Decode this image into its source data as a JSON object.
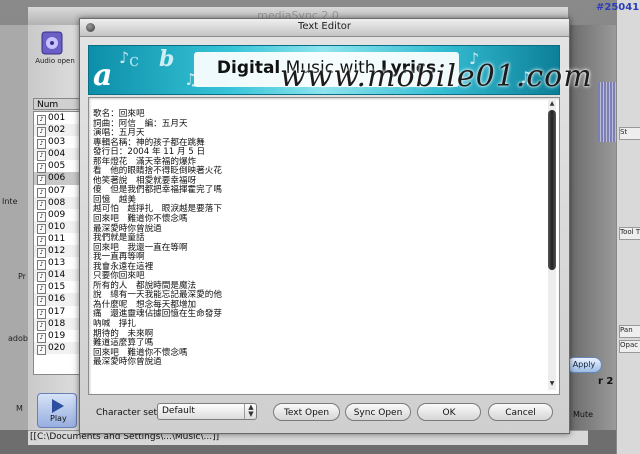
{
  "background_app": {
    "title": "mediaSync 2.0",
    "audio_open_label": "Audio open",
    "num_header": "Num",
    "tracks": [
      "001",
      "002",
      "003",
      "004",
      "005",
      "006",
      "007",
      "008",
      "009",
      "010",
      "011",
      "012",
      "013",
      "014",
      "015",
      "016",
      "017",
      "018",
      "019",
      "020"
    ],
    "left_labels": [
      "Inte",
      "Pr",
      "adob",
      "M"
    ],
    "play_label": "Play",
    "status_text": "[[C:\\Documents and Settings\\...\\Music\\...]]",
    "right_buttons": [
      "St",
      "Tool T",
      "Pan",
      "Opac"
    ],
    "apply_label": "Apply",
    "mute_label": "Mute",
    "r2_label": "r 2",
    "tag": "#25041"
  },
  "dialog": {
    "title": "Text Editor",
    "banner": {
      "title_plain": "Digital Music with ",
      "title_bold_a": "Digital",
      "title_bold_b": "Lyrics",
      "letters": [
        "a",
        "b",
        "c"
      ],
      "watermark": "www.mobile01.com"
    },
    "lyrics": [
      "歌名：回來吧",
      "詞曲：阿信　編：五月天",
      "演唱：五月天",
      "專輯名稱：神的孩子都在跳舞",
      "發行日：2004 年 11 月 5 日",
      "那年燈花　滿天幸福的爆炸",
      "看　他的眼睛捨不得眨倒映著火花",
      "他笑著說　相愛就要幸福呀",
      "傻　但是我們都把幸福揮霍完了嗎",
      "回憶　越美",
      "越可怕　越掙扎　眼淚越是要落下",
      "回來吧　難道你不懷念嗎",
      "最深愛時你曾說過",
      "我們就是童話",
      "回來吧　我還一直在等啊",
      "我一直再等啊",
      "我會永遠在這裡",
      "只要你回來吧",
      "所有的人　都說時間是魔法",
      "說　總有一天我能忘記最深愛的他",
      "為什麼呢　想念每天都增加",
      "痛　還進靈魂佔據回憶在生命發芽",
      "吶喊　掙扎",
      "期待的　未來啊",
      "難道這麼算了嗎",
      "回來吧　難道你不懷念嗎",
      "最深愛時你曾說過"
    ],
    "charset_label": "Character set",
    "charset_value": "Default",
    "buttons": {
      "text_open": "Text Open",
      "sync_open": "Sync Open",
      "ok": "OK",
      "cancel": "Cancel"
    }
  }
}
